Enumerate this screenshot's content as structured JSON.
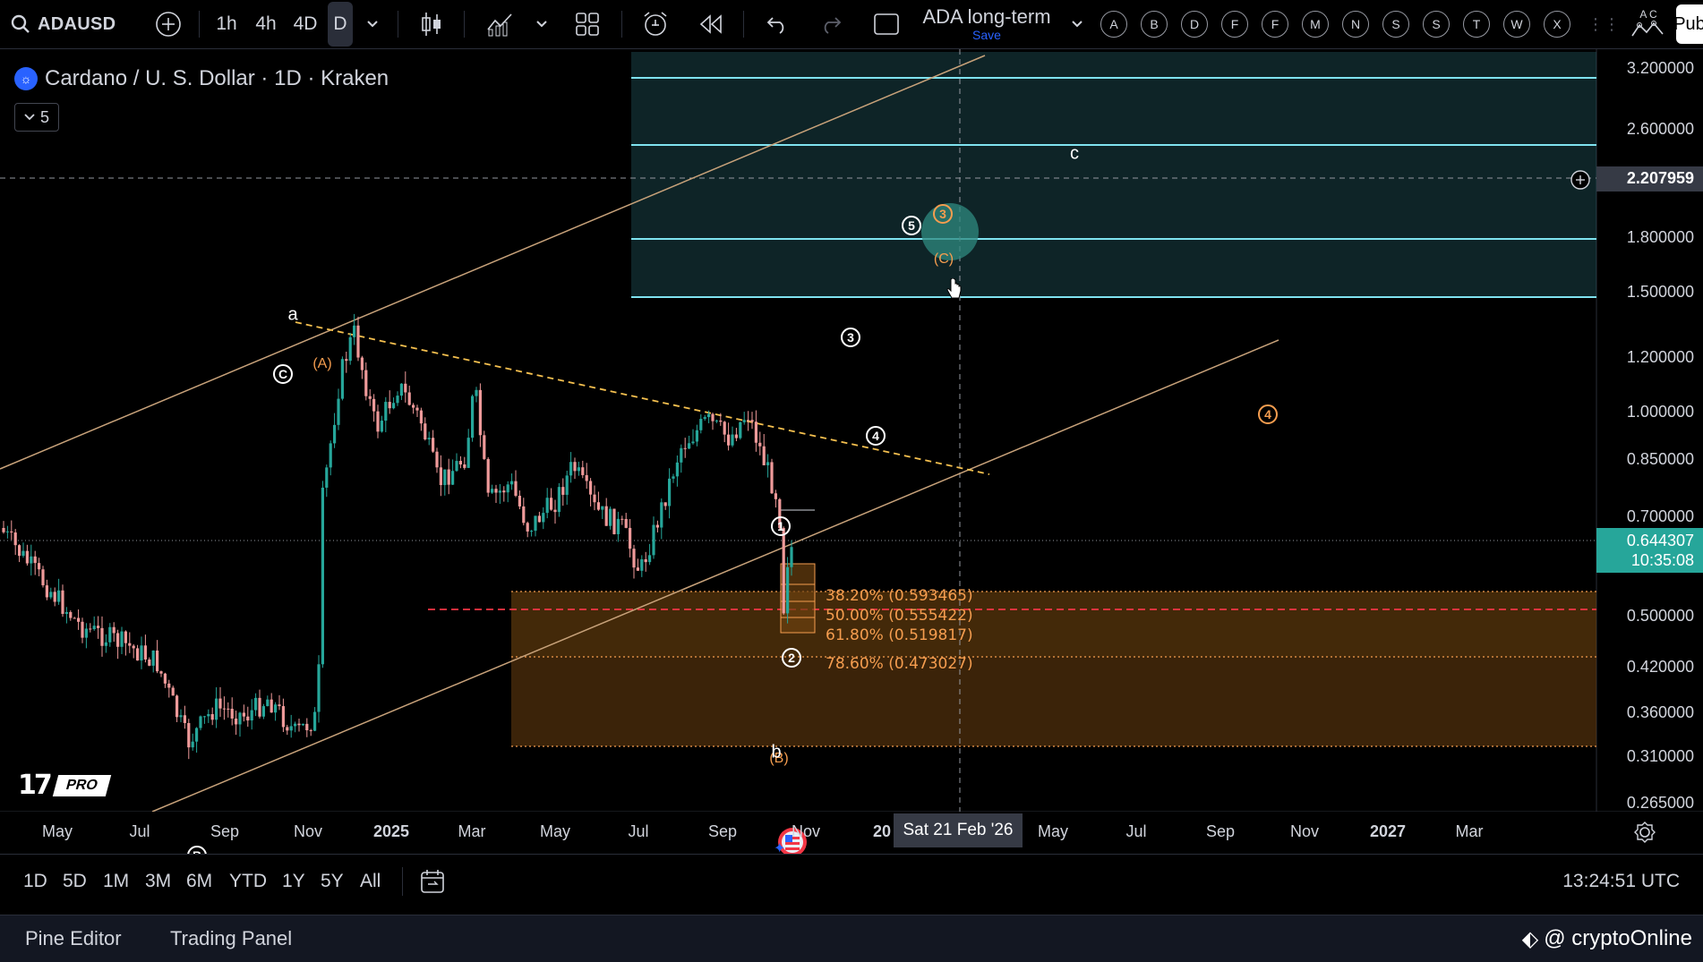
{
  "toolbar": {
    "symbol": "ADAUSD",
    "timeframes": [
      "1h",
      "4h",
      "4D",
      "D"
    ],
    "active_timeframe": "D",
    "layout_name": "ADA long-term",
    "layout_status": "Save",
    "alphabet_buttons": [
      "A",
      "B",
      "D",
      "F",
      "F",
      "M",
      "N",
      "S",
      "S",
      "T",
      "W",
      "X"
    ],
    "publish_label": "Pub",
    "corner_letters": "A C"
  },
  "legend": {
    "title": "Cardano / U. S. Dollar · 1D · Kraken",
    "indicator_count": "5"
  },
  "price_axis": {
    "labels": [
      "3.200000",
      "2.600000",
      "2.207959",
      "1.800000",
      "1.500000",
      "1.200000",
      "1.000000",
      "0.850000",
      "0.700000",
      "0.500000",
      "0.420000",
      "0.360000",
      "0.310000",
      "0.265000"
    ],
    "crosshair_price": "2.207959",
    "last_price": "0.644307",
    "countdown": "10:35:08",
    "colors": {
      "last_price_bg": "#26a69a",
      "crosshair_bg": "#363a45"
    }
  },
  "time_axis": {
    "labels": [
      "May",
      "Jul",
      "Sep",
      "Nov",
      "2025",
      "Mar",
      "May",
      "Jul",
      "Sep",
      "Nov",
      "20",
      "May",
      "Jul",
      "Sep",
      "Nov",
      "2027",
      "Mar"
    ],
    "crosshair_date": "Sat 21 Feb '26"
  },
  "fib": {
    "levels": [
      {
        "ratio": "38.20%",
        "price": "0.593465",
        "text": "38.20% (0.593465)"
      },
      {
        "ratio": "50.00%",
        "price": "0.555422",
        "text": "50.00% (0.555422)"
      },
      {
        "ratio": "61.80%",
        "price": "0.519817",
        "text": "61.80% (0.519817)"
      },
      {
        "ratio": "78.60%",
        "price": "0.473027",
        "text": "78.60% (0.473027)"
      }
    ],
    "color": "#f59d4f"
  },
  "waves": {
    "lowercase": [
      "a",
      "b",
      "c"
    ],
    "white_numbers": [
      "1",
      "2",
      "3",
      "4",
      "5"
    ],
    "orange_numbers": [
      "3",
      "4"
    ],
    "letters": [
      "C",
      "B"
    ],
    "orange_letters": [
      "(A)",
      "(B)",
      "(C)"
    ]
  },
  "range_bar": {
    "ranges": [
      "1D",
      "5D",
      "1M",
      "3M",
      "6M",
      "YTD",
      "1Y",
      "5Y",
      "All"
    ],
    "clock": "13:24:51 UTC"
  },
  "bottom_bar": {
    "tabs": [
      "Pine Editor",
      "Trading Panel"
    ],
    "watermark": "@ cryptoOnline"
  },
  "branding": {
    "pro_badge": "PRO",
    "logo_text": "17"
  }
}
